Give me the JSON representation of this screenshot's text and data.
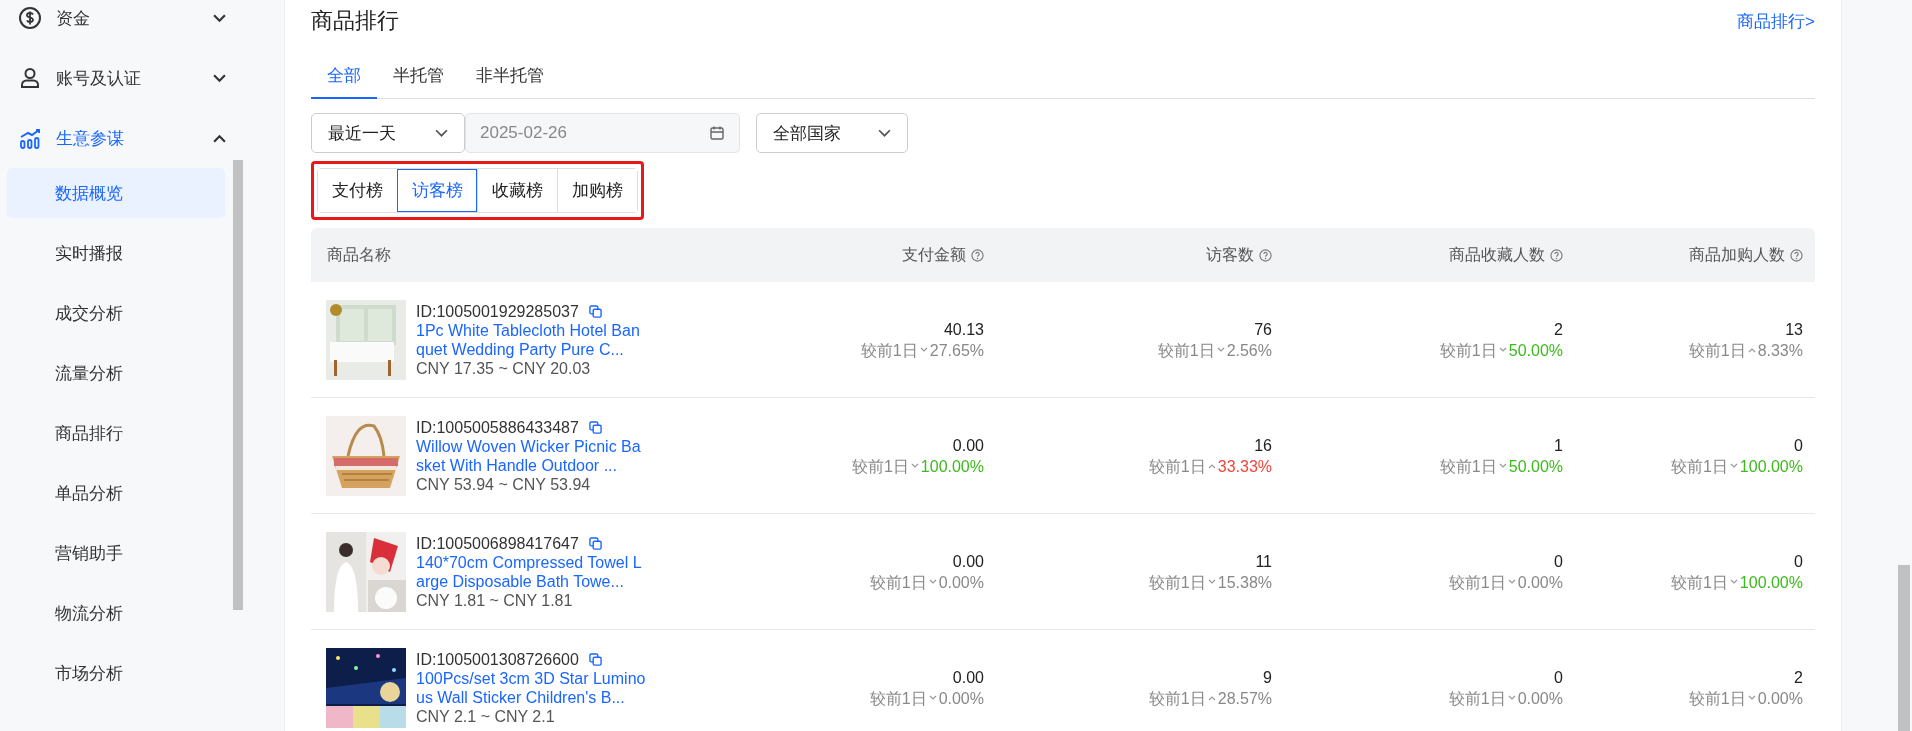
{
  "sidebar": {
    "items": [
      {
        "label": "资金",
        "expanded": false,
        "selected": false
      },
      {
        "label": "账号及认证",
        "expanded": false,
        "selected": false
      },
      {
        "label": "生意参谋",
        "expanded": true,
        "selected": true,
        "children": [
          {
            "label": "数据概览",
            "selected": true
          },
          {
            "label": "实时播报",
            "selected": false
          },
          {
            "label": "成交分析",
            "selected": false
          },
          {
            "label": "流量分析",
            "selected": false
          },
          {
            "label": "商品排行",
            "selected": false
          },
          {
            "label": "单品分析",
            "selected": false
          },
          {
            "label": "营销助手",
            "selected": false
          },
          {
            "label": "物流分析",
            "selected": false
          },
          {
            "label": "市场分析",
            "selected": false
          }
        ]
      }
    ]
  },
  "section": {
    "title": "商品排行",
    "link": "商品排行>"
  },
  "tabs": [
    {
      "label": "全部",
      "selected": true
    },
    {
      "label": "半托管",
      "selected": false
    },
    {
      "label": "非半托管",
      "selected": false
    }
  ],
  "filters": {
    "period": "最近一天",
    "date": "2025-02-26",
    "country": "全部国家"
  },
  "rank_types": [
    {
      "label": "支付榜",
      "selected": false
    },
    {
      "label": "访客榜",
      "selected": true
    },
    {
      "label": "收藏榜",
      "selected": false
    },
    {
      "label": "加购榜",
      "selected": false
    }
  ],
  "table": {
    "columns": [
      {
        "label": "商品名称",
        "help": false
      },
      {
        "label": "支付金额",
        "help": true
      },
      {
        "label": "访客数",
        "help": true
      },
      {
        "label": "商品收藏人数",
        "help": true
      },
      {
        "label": "商品加购人数",
        "help": true
      }
    ],
    "rows": [
      {
        "id": "ID:1005001929285037",
        "title": "1Pc White Tablecloth Hotel Banquet Wedding Party Pure C...",
        "price": "CNY 17.35 ~ CNY 20.03",
        "metrics": [
          {
            "value": "40.13",
            "compare": "较前1日",
            "up": false,
            "change": "27.65%",
            "color": "#888888"
          },
          {
            "value": "76",
            "compare": "较前1日",
            "up": false,
            "change": "2.56%",
            "color": "#888888"
          },
          {
            "value": "2",
            "compare": "较前1日",
            "up": false,
            "change": "50.00%",
            "color": "#3cba1c"
          },
          {
            "value": "13",
            "compare": "较前1日",
            "up": true,
            "change": "8.33%",
            "color": "#888888"
          }
        ]
      },
      {
        "id": "ID:1005005886433487",
        "title": "Willow Woven Wicker Picnic Basket With Handle Outdoor ...",
        "price": "CNY 53.94 ~ CNY 53.94",
        "metrics": [
          {
            "value": "0.00",
            "compare": "较前1日",
            "up": false,
            "change": "100.00%",
            "color": "#3cba1c"
          },
          {
            "value": "16",
            "compare": "较前1日",
            "up": true,
            "change": "33.33%",
            "color": "#f0453a"
          },
          {
            "value": "1",
            "compare": "较前1日",
            "up": false,
            "change": "50.00%",
            "color": "#3cba1c"
          },
          {
            "value": "0",
            "compare": "较前1日",
            "up": false,
            "change": "100.00%",
            "color": "#3cba1c"
          }
        ]
      },
      {
        "id": "ID:1005006898417647",
        "title": "140*70cm Compressed Towel Large Disposable Bath Towe...",
        "price": "CNY 1.81 ~ CNY 1.81",
        "metrics": [
          {
            "value": "0.00",
            "compare": "较前1日",
            "up": false,
            "change": "0.00%",
            "color": "#888888"
          },
          {
            "value": "11",
            "compare": "较前1日",
            "up": false,
            "change": "15.38%",
            "color": "#888888"
          },
          {
            "value": "0",
            "compare": "较前1日",
            "up": false,
            "change": "0.00%",
            "color": "#888888"
          },
          {
            "value": "0",
            "compare": "较前1日",
            "up": false,
            "change": "100.00%",
            "color": "#3cba1c"
          }
        ]
      },
      {
        "id": "ID:1005001308726600",
        "title": "100Pcs/set 3cm 3D Star Luminous Wall Sticker Children's B...",
        "price": "CNY 2.1 ~ CNY 2.1",
        "metrics": [
          {
            "value": "0.00",
            "compare": "较前1日",
            "up": false,
            "change": "0.00%",
            "color": "#888888"
          },
          {
            "value": "9",
            "compare": "较前1日",
            "up": true,
            "change": "28.57%",
            "color": "#888888"
          },
          {
            "value": "0",
            "compare": "较前1日",
            "up": false,
            "change": "0.00%",
            "color": "#888888"
          },
          {
            "value": "2",
            "compare": "较前1日",
            "up": false,
            "change": "0.00%",
            "color": "#888888"
          }
        ]
      }
    ]
  }
}
